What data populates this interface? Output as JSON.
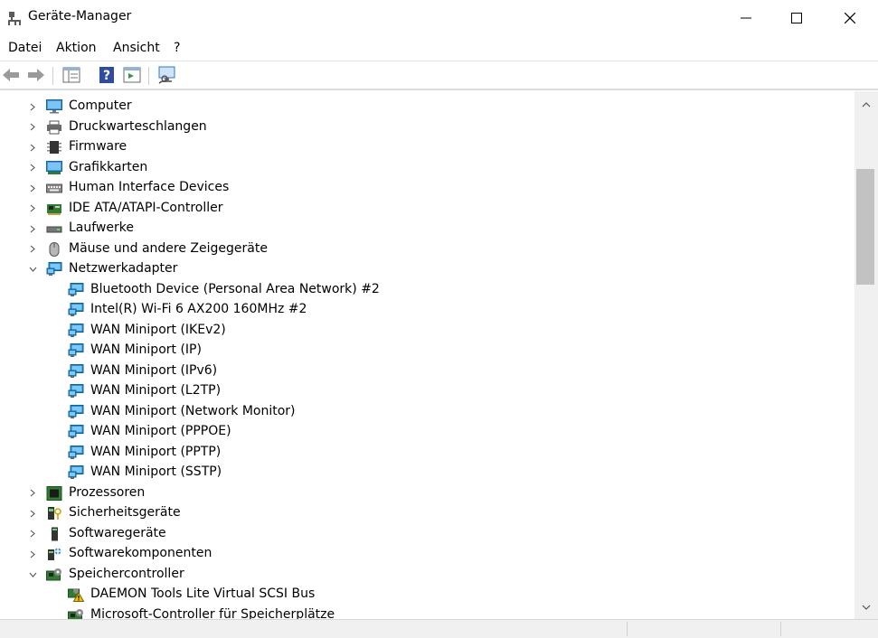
{
  "window": {
    "title": "Geräte-Manager"
  },
  "menu": {
    "items": [
      "Datei",
      "Aktion",
      "Ansicht",
      "?"
    ]
  },
  "tree": {
    "rows": [
      {
        "label": "Computer",
        "level": 0,
        "expander": "collapsed",
        "icon": "computer"
      },
      {
        "label": "Druckwarteschlangen",
        "level": 0,
        "expander": "collapsed",
        "icon": "printer"
      },
      {
        "label": "Firmware",
        "level": 0,
        "expander": "collapsed",
        "icon": "chip"
      },
      {
        "label": "Grafikkarten",
        "level": 0,
        "expander": "collapsed",
        "icon": "display-adapter"
      },
      {
        "label": "Human Interface Devices",
        "level": 0,
        "expander": "collapsed",
        "icon": "keyboard"
      },
      {
        "label": "IDE ATA/ATAPI-Controller",
        "level": 0,
        "expander": "collapsed",
        "icon": "ide-controller"
      },
      {
        "label": "Laufwerke",
        "level": 0,
        "expander": "collapsed",
        "icon": "drive"
      },
      {
        "label": "Mäuse und andere Zeigegeräte",
        "level": 0,
        "expander": "collapsed",
        "icon": "mouse"
      },
      {
        "label": "Netzwerkadapter",
        "level": 0,
        "expander": "expanded",
        "icon": "network"
      },
      {
        "label": "Bluetooth Device (Personal Area Network) #2",
        "level": 1,
        "expander": "none",
        "icon": "network"
      },
      {
        "label": "Intel(R) Wi-Fi 6 AX200 160MHz #2",
        "level": 1,
        "expander": "none",
        "icon": "network"
      },
      {
        "label": "WAN Miniport (IKEv2)",
        "level": 1,
        "expander": "none",
        "icon": "network"
      },
      {
        "label": "WAN Miniport (IP)",
        "level": 1,
        "expander": "none",
        "icon": "network"
      },
      {
        "label": "WAN Miniport (IPv6)",
        "level": 1,
        "expander": "none",
        "icon": "network"
      },
      {
        "label": "WAN Miniport (L2TP)",
        "level": 1,
        "expander": "none",
        "icon": "network"
      },
      {
        "label": "WAN Miniport (Network Monitor)",
        "level": 1,
        "expander": "none",
        "icon": "network"
      },
      {
        "label": "WAN Miniport (PPPOE)",
        "level": 1,
        "expander": "none",
        "icon": "network"
      },
      {
        "label": "WAN Miniport (PPTP)",
        "level": 1,
        "expander": "none",
        "icon": "network"
      },
      {
        "label": "WAN Miniport (SSTP)",
        "level": 1,
        "expander": "none",
        "icon": "network"
      },
      {
        "label": "Prozessoren",
        "level": 0,
        "expander": "collapsed",
        "icon": "processor"
      },
      {
        "label": "Sicherheitsgeräte",
        "level": 0,
        "expander": "collapsed",
        "icon": "security"
      },
      {
        "label": "Softwaregeräte",
        "level": 0,
        "expander": "collapsed",
        "icon": "software-device"
      },
      {
        "label": "Softwarekomponenten",
        "level": 0,
        "expander": "collapsed",
        "icon": "software-component"
      },
      {
        "label": "Speichercontroller",
        "level": 0,
        "expander": "expanded",
        "icon": "storage-controller"
      },
      {
        "label": "DAEMON Tools Lite Virtual SCSI Bus",
        "level": 1,
        "expander": "none",
        "icon": "storage-warning"
      },
      {
        "label": "Microsoft-Controller für Speicherplätze",
        "level": 1,
        "expander": "none",
        "icon": "storage-controller"
      }
    ]
  },
  "colors": {
    "network_blue": "#1f8fd8",
    "monitor_blue": "#3b9be0",
    "warning_yellow": "#f5c400"
  }
}
